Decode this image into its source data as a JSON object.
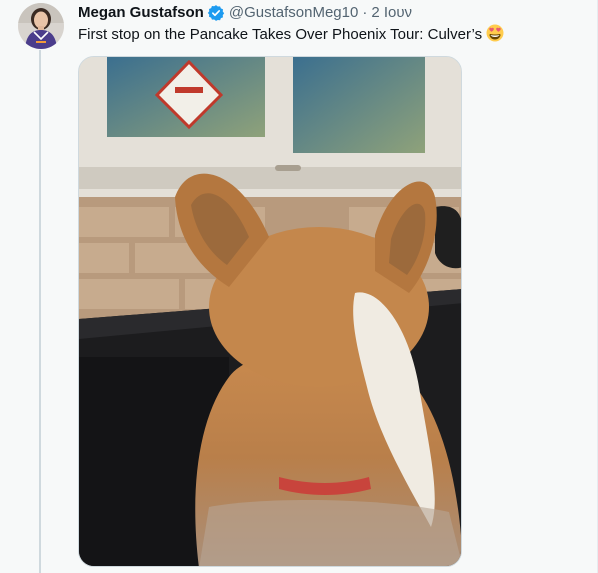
{
  "tweet": {
    "author": {
      "display_name": "Megan Gustafson",
      "handle": "@GustafsonMeg10",
      "verified": true
    },
    "separator": "·",
    "timestamp": "2 Ιουν",
    "text": "First stop on the Pancake Takes Over Phoenix Tour: Culver’s",
    "emoji": "heart-eyes-emoji",
    "media": {
      "type": "photo",
      "subject": "corgi-in-car-window"
    }
  },
  "colors": {
    "name_text": "#0f1419",
    "secondary_text": "#536471",
    "verified_blue": "#1d9bf0",
    "thread_line": "#cfd9de",
    "background": "#f7f9f9"
  }
}
